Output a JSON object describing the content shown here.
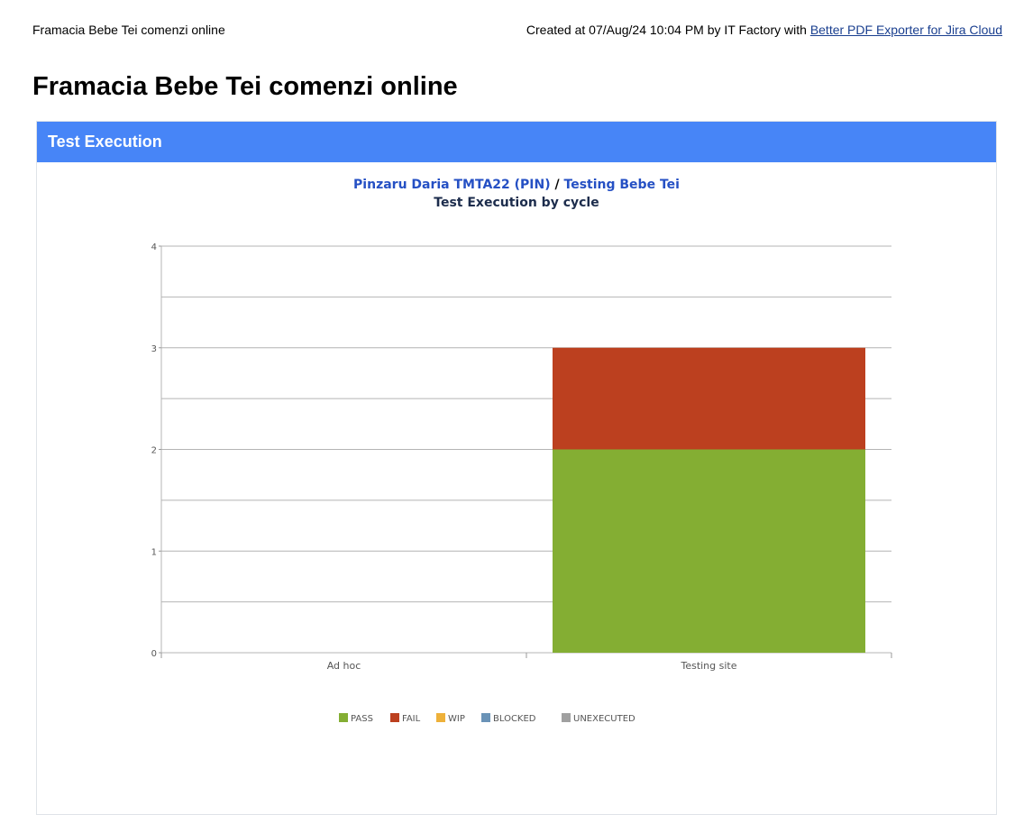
{
  "page": {
    "header_left": "Framacia Bebe Tei comenzi online",
    "created_text": "Created at 07/Aug/24 10:04 PM by IT Factory with ",
    "exporter_link": "Better PDF Exporter for Jira Cloud",
    "title": "Framacia Bebe Tei comenzi online"
  },
  "panel": {
    "header": "Test Execution",
    "project_link": "Pinzaru Daria TMTA22 (PIN)",
    "separator": " / ",
    "version_link": "Testing Bebe Tei"
  },
  "chart_data": {
    "type": "bar",
    "stacked": true,
    "title": "Test Execution by cycle",
    "categories": [
      "Ad hoc",
      "Testing site"
    ],
    "series": [
      {
        "name": "PASS",
        "color": "#84ae33",
        "values": [
          0,
          2
        ]
      },
      {
        "name": "FAIL",
        "color": "#bc401f",
        "values": [
          0,
          1
        ]
      },
      {
        "name": "WIP",
        "color": "#eeb13a",
        "values": [
          0,
          0
        ]
      },
      {
        "name": "BLOCKED",
        "color": "#6a93b7",
        "values": [
          0,
          0
        ]
      },
      {
        "name": "UNEXECUTED",
        "color": "#a0a0a0",
        "values": [
          0,
          0
        ]
      }
    ],
    "ylim": [
      0,
      4
    ],
    "yticks": [
      0,
      1,
      2,
      3,
      4
    ],
    "grid": true,
    "legend": "bottom"
  }
}
